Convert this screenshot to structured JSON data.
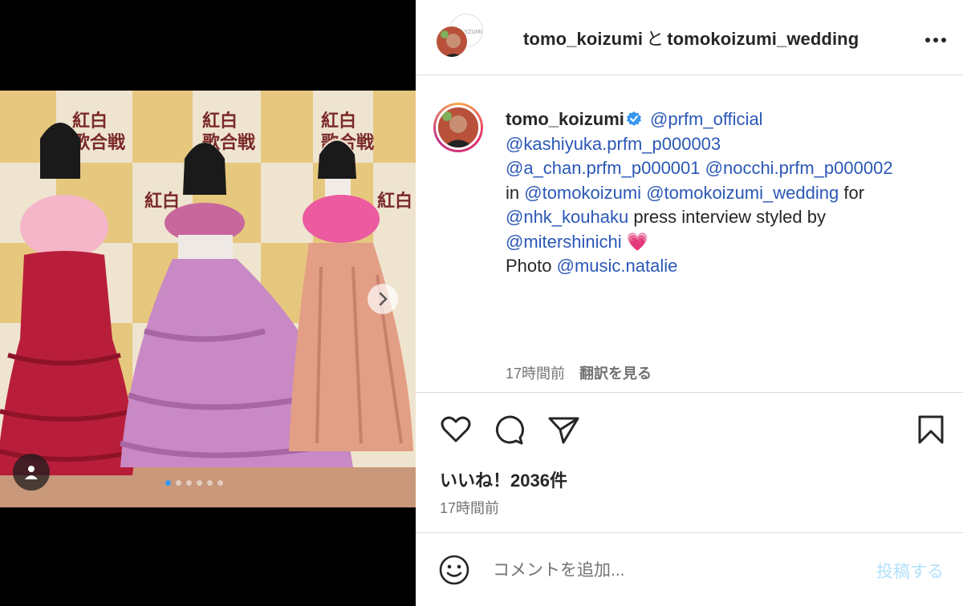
{
  "header": {
    "author": "tomo_koizumi",
    "conjunction": "と",
    "collaborator": "tomokoizumi_wedding",
    "more_icon": "more-horizontal-icon"
  },
  "caption": {
    "username": "tomo_koizumi",
    "verified_icon": "verified-badge-icon",
    "segments": {
      "m1": "@prfm_official",
      "m2": "@kashiyuka.prfm_p000003",
      "m3": "@a_chan.prfm_p000001",
      "m4": "@nocchi.prfm_p000002",
      "t1": "in",
      "m5": "@tomokoizumi",
      "m6": "@tomokoizumi_wedding",
      "t2": "for",
      "m7": "@nhk_kouhaku",
      "t3": "press interview styled by",
      "m8": "@mitershinichi",
      "emoji": "💗",
      "t4": "Photo",
      "m9": "@music.natalie"
    },
    "time_ago": "17時間前",
    "translate": "翻訳を見る"
  },
  "actions": {
    "like_icon": "heart-icon",
    "comment_icon": "comment-icon",
    "share_icon": "share-icon",
    "save_icon": "bookmark-icon"
  },
  "likes_text": "いいね！2036件",
  "post_time": "17時間前",
  "comment": {
    "emoji_icon": "smiley-icon",
    "placeholder": "コメントを追加...",
    "post_label": "投稿する"
  },
  "media": {
    "carousel_total": 6,
    "carousel_active": 1,
    "next_icon": "chevron-right-icon",
    "tag_icon": "user-tag-icon"
  },
  "colors": {
    "mention": "#2b58b6",
    "secondary": "#737373",
    "post_disabled": "#b2dffc",
    "dot_active": "#3897f0"
  }
}
